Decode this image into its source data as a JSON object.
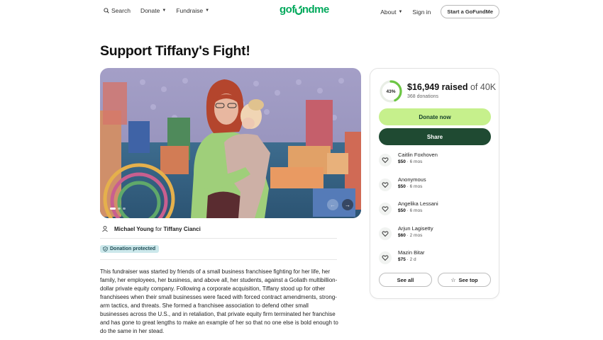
{
  "header": {
    "search_label": "Search",
    "donate_label": "Donate",
    "fundraise_label": "Fundraise",
    "logo_text_left": "gof",
    "logo_text_right": "ndme",
    "about_label": "About",
    "signin_label": "Sign in",
    "start_label": "Start a GoFundMe"
  },
  "page": {
    "title": "Support Tiffany's Fight!"
  },
  "organizer": {
    "name": "Michael Young",
    "connector": "for",
    "beneficiary": "Tiffany Cianci"
  },
  "badge": {
    "label": "Donation protected"
  },
  "story": "This fundraiser was started by friends of a small business franchisee fighting for her life, her family, her employees, her business, and above all, her students, against a Goliath multibillion-dollar private equity company. Following a corporate acquisition, Tiffany stood up for other franchisees when their small businesses were faced with forced contract amendments, strong-arm tactics, and threats. She formed a franchisee association to defend other small businesses across the U.S., and in retaliation, that private equity firm terminated her franchise and has gone to great lengths to make an example of her so that no one else is bold enough to do the same in her stead.",
  "campaign": {
    "progress_percent": 43,
    "progress_label": "43%",
    "raised": "$16,949 raised",
    "goal": "of 40K",
    "donations": "368 donations",
    "donate_button": "Donate now",
    "share_button": "Share",
    "see_all_button": "See all",
    "see_top_button": "See top"
  },
  "donors": [
    {
      "name": "Caitlin Foxhoven",
      "amount": "$50",
      "time": "6 mos"
    },
    {
      "name": "Anonymous",
      "amount": "$50",
      "time": "6 mos"
    },
    {
      "name": "Angelika Lessani",
      "amount": "$50",
      "time": "6 mos"
    },
    {
      "name": "Arjun Lagisetty",
      "amount": "$60",
      "time": "2 mos"
    },
    {
      "name": "Mazin Bitar",
      "amount": "$75",
      "time": "2 d"
    }
  ],
  "icons": {
    "search": "search-icon",
    "user": "user-icon",
    "shield": "shield-icon",
    "donation": "heart-hand-icon",
    "star": "star-icon",
    "arrow_prev": "arrow-left-icon",
    "arrow_next": "arrow-right-icon"
  },
  "colors": {
    "brand_green": "#02a95c",
    "donate_button": "#c6f08c",
    "share_button": "#1f4a32",
    "progress": "#6cc644",
    "badge_bg": "#cce8eb"
  }
}
